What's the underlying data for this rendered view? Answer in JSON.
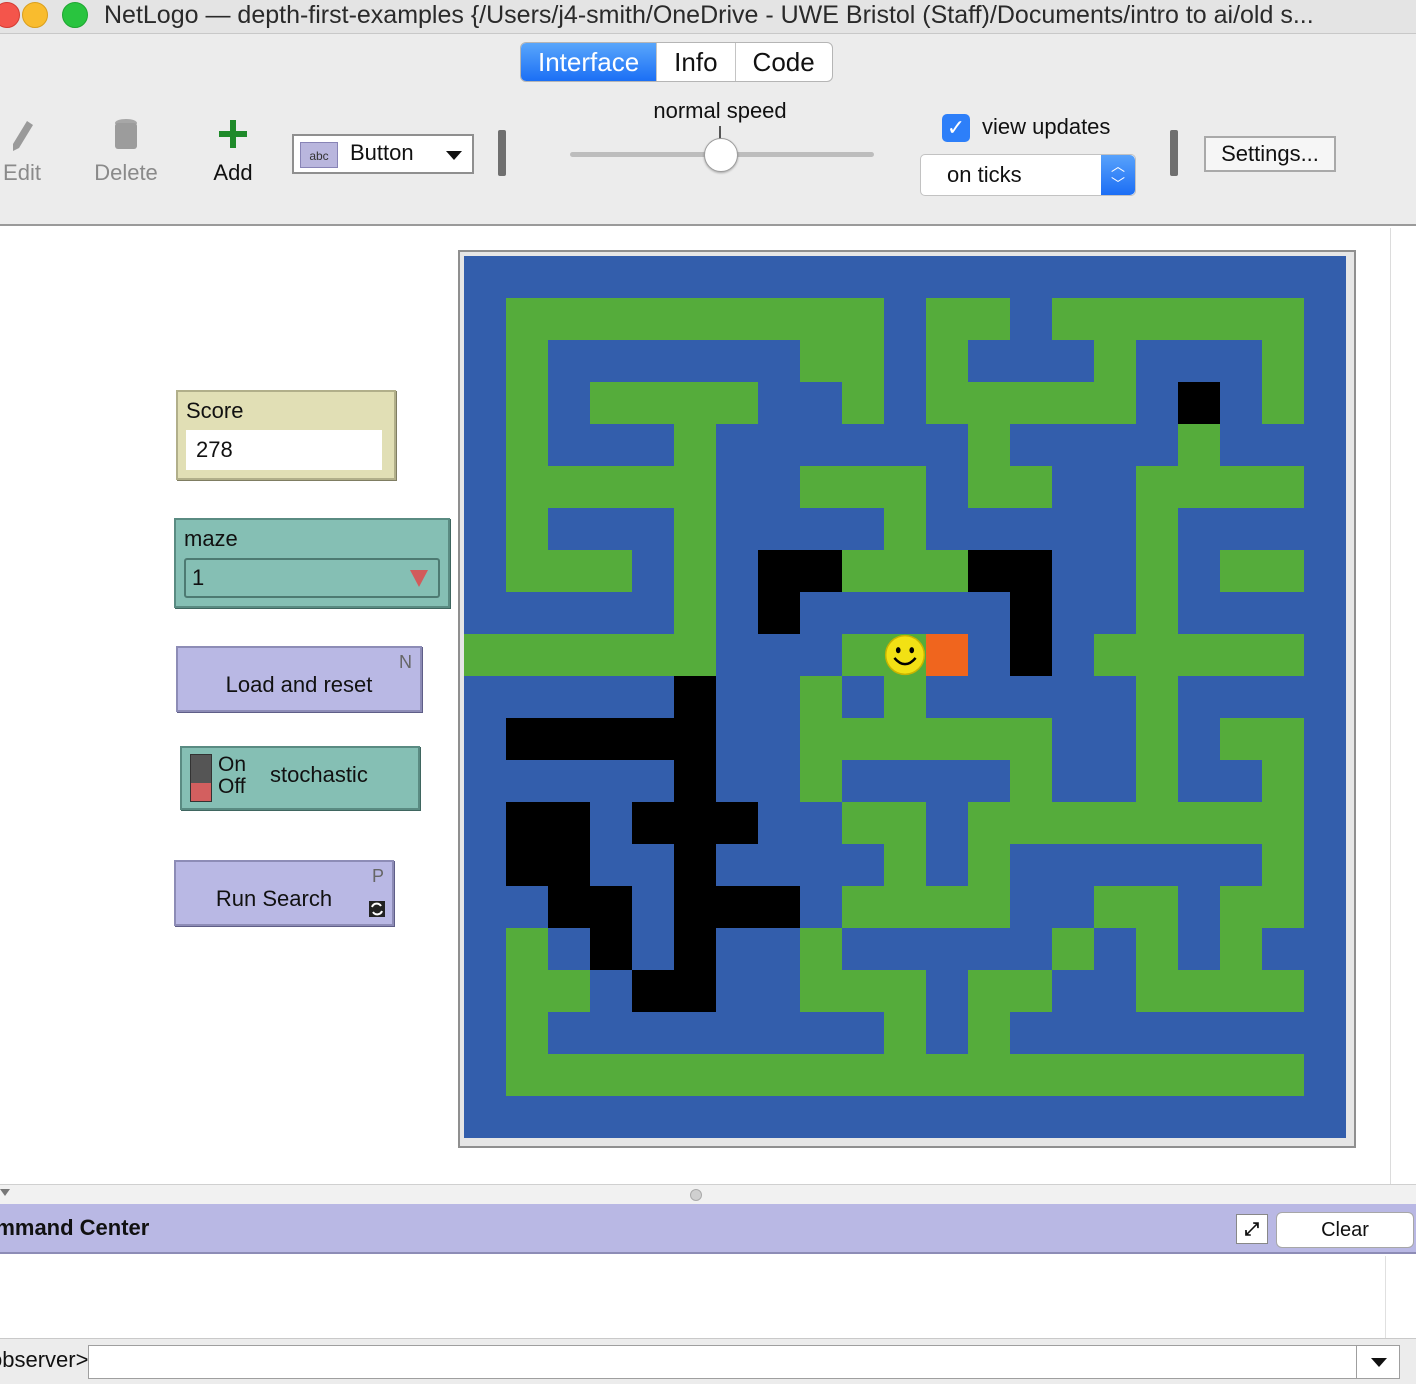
{
  "window": {
    "title": "NetLogo — depth-first-examples {/Users/j4-smith/OneDrive - UWE Bristol (Staff)/Documents/intro to ai/old s..."
  },
  "tabs": [
    {
      "label": "Interface",
      "active": true
    },
    {
      "label": "Info",
      "active": false
    },
    {
      "label": "Code",
      "active": false
    }
  ],
  "toolbar": {
    "edit_label": "Edit",
    "delete_label": "Delete",
    "add_label": "Add",
    "widget_type": "Button",
    "widget_icon_text": "abc",
    "speed_label": "normal speed",
    "speed_fraction": 0.5,
    "view_updates_label": "view updates",
    "view_updates_checked": true,
    "update_mode": "on ticks",
    "settings_label": "Settings..."
  },
  "widgets": {
    "score": {
      "label": "Score",
      "value": "278"
    },
    "maze": {
      "label": "maze",
      "value": "1"
    },
    "load_button": {
      "label": "Load and reset",
      "key": "N"
    },
    "stochastic_switch": {
      "label": "stochastic",
      "on_label": "On",
      "off_label": "Off",
      "is_on": false
    },
    "run_button": {
      "label": "Run Search",
      "key": "P",
      "forever": true
    }
  },
  "world": {
    "cols": 21,
    "rows": 21,
    "colors": {
      "B": "#335eac",
      "G": "#55ac3b",
      "K": "#000000",
      "O": "#f0651e"
    },
    "grid": [
      "BBBBBBBBBBBBBBBBBBBBB",
      "BGGGGGGGGGBGGBGGGGGGB",
      "BGBBBBBBGGBGBBBGBBBGB",
      "BGBGGGGBBGBGGGGGBKBGB",
      "BGBBBGBBBBBBGBBBBGBBB",
      "BGGGGGBBGGGBGGBBGGGGB",
      "BGBBBGBBBBGBBBBBGBBBB",
      "BGGGBGBKKGGGKKBBGBGGB",
      "BBBBBGBKBBBBBKBBGBBBB",
      "GGGGGGBBBGGOBKBGGGGGB",
      "BBBBBKBBGBGBBBBBGBBBB",
      "BKKKKKBBGGGGGGBBGBGGB",
      "BBBBBKBBGBBBBGBBGBBGB",
      "BKKBKKKBBGGBGGGGGGGGB",
      "BKKBBKBBBBGBGBBBBBBGB",
      "BBKKBKKKBGGGGBBGGBGGB",
      "BGBKBKBBGBBBBBGBGBGBB",
      "BGGBKKBBGGGBGGBBGGGGB",
      "BGBBBBBBBBGBGBBBBBBBB",
      "BGGGGGGGGGGGGGGGGGGGB",
      "BBBBBBBBBBBBBBBBBBBBB"
    ],
    "agent": {
      "col": 10,
      "row": 9,
      "shape": "face-happy",
      "color": "#f2e114"
    }
  },
  "command_center": {
    "title": "Command Center",
    "clear_label": "Clear",
    "prompt": "observer>",
    "input_value": ""
  }
}
